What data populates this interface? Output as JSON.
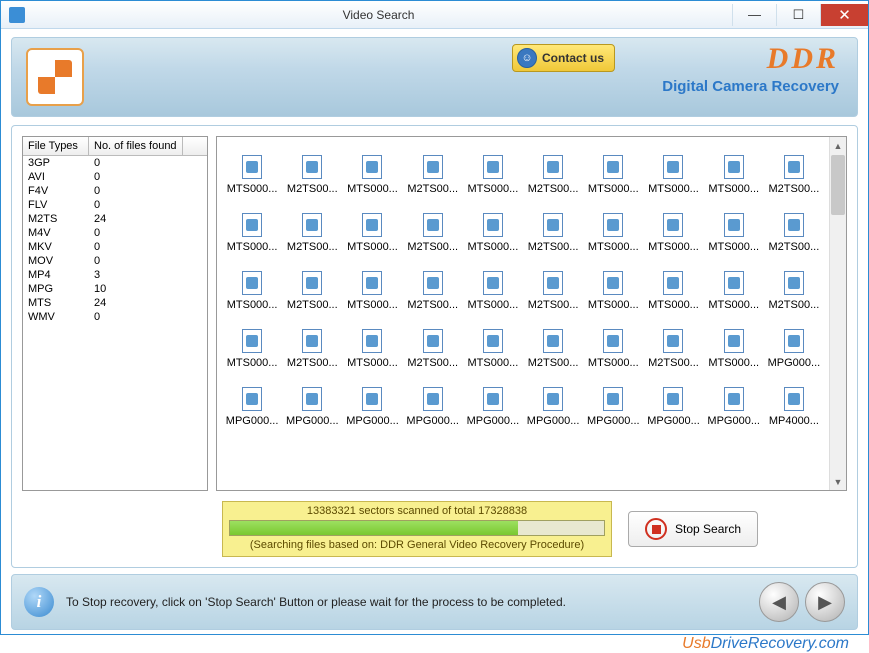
{
  "window": {
    "title": "Video Search"
  },
  "banner": {
    "contact_label": "Contact us",
    "brand": "DDR",
    "subtitle": "Digital Camera Recovery"
  },
  "table": {
    "col1": "File Types",
    "col2": "No. of files found",
    "rows": [
      {
        "t": "3GP",
        "n": "0"
      },
      {
        "t": "AVI",
        "n": "0"
      },
      {
        "t": "F4V",
        "n": "0"
      },
      {
        "t": "FLV",
        "n": "0"
      },
      {
        "t": "M2TS",
        "n": "24"
      },
      {
        "t": "M4V",
        "n": "0"
      },
      {
        "t": "MKV",
        "n": "0"
      },
      {
        "t": "MOV",
        "n": "0"
      },
      {
        "t": "MP4",
        "n": "3"
      },
      {
        "t": "MPG",
        "n": "10"
      },
      {
        "t": "MTS",
        "n": "24"
      },
      {
        "t": "WMV",
        "n": "0"
      }
    ]
  },
  "files": [
    "MTS000...",
    "M2TS00...",
    "MTS000...",
    "M2TS00...",
    "MTS000...",
    "M2TS00...",
    "MTS000...",
    "MTS000...",
    "MTS000...",
    "M2TS00...",
    "MTS000...",
    "M2TS00...",
    "MTS000...",
    "M2TS00...",
    "MTS000...",
    "M2TS00...",
    "MTS000...",
    "MTS000...",
    "MTS000...",
    "M2TS00...",
    "MTS000...",
    "M2TS00...",
    "MTS000...",
    "M2TS00...",
    "MTS000...",
    "M2TS00...",
    "MTS000...",
    "MTS000...",
    "MTS000...",
    "M2TS00...",
    "MTS000...",
    "M2TS00...",
    "MTS000...",
    "M2TS00...",
    "MTS000...",
    "M2TS00...",
    "MTS000...",
    "M2TS00...",
    "MTS000...",
    "MPG000...",
    "MPG000...",
    "MPG000...",
    "MPG000...",
    "MPG000...",
    "MPG000...",
    "MPG000...",
    "MPG000...",
    "MPG000...",
    "MPG000...",
    "MP4000..."
  ],
  "progress": {
    "sectors_line": "13383321 sectors scanned of total 17328838",
    "procedure_line": "(Searching files based on:  DDR General Video Recovery Procedure)",
    "percent": 77
  },
  "buttons": {
    "stop": "Stop Search"
  },
  "info": {
    "text": "To Stop recovery, click on 'Stop Search' Button or please wait for the process to be completed."
  },
  "footer": {
    "prefix": "Usb",
    "rest": "DriveRecovery.com"
  }
}
